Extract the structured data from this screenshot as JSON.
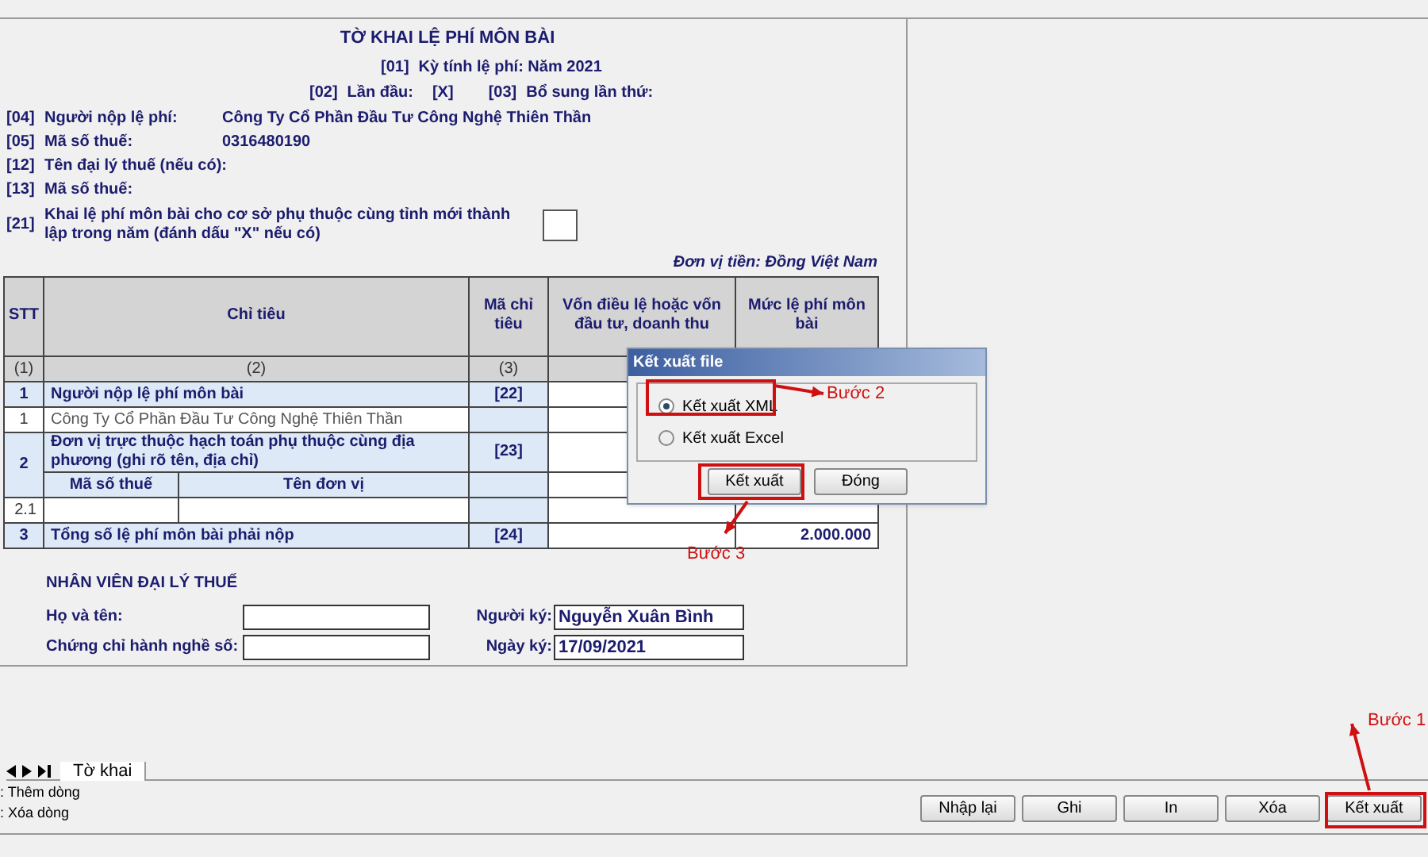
{
  "form": {
    "title": "TỜ KHAI LỆ PHÍ MÔN BÀI",
    "period": {
      "code": "[01]",
      "label": "Kỳ tính lệ phí: Năm 2021"
    },
    "first_time": {
      "code": "[02]",
      "label": "Lần đầu:",
      "value": "[X]"
    },
    "supplement": {
      "code": "[03]",
      "label": "Bổ sung lần thứ:"
    },
    "fields": [
      {
        "code": "[04]",
        "label": "Người nộp lệ phí:",
        "value": "Công Ty Cổ Phần Đầu Tư Công Nghệ Thiên Thần"
      },
      {
        "code": "[05]",
        "label": "Mã số thuế:",
        "value": "0316480190"
      },
      {
        "code": "[12]",
        "label": "Tên đại lý thuế (nếu có):"
      },
      {
        "code": "[13]",
        "label": "Mã số thuế:"
      }
    ],
    "dependent_checkbox": {
      "code": "[21]",
      "label": "Khai lệ phí môn bài cho cơ sở phụ thuộc cùng tỉnh mới thành lập trong năm (đánh dấu \"X\" nếu có)",
      "checked": false
    },
    "currency": "Đơn vị tiền: Đồng Việt Nam",
    "table": {
      "columns": [
        "STT",
        "Chỉ tiêu",
        "Mã chỉ tiêu",
        "Vốn điều lệ hoặc vốn đầu tư, doanh thu",
        "Mức lệ phí môn bài"
      ],
      "index_row": [
        "(1)",
        "(2)",
        "(3)"
      ],
      "rows": [
        {
          "kind": "section",
          "stt": "1",
          "label": "Người nộp lệ phí môn bài",
          "code": "[22]"
        },
        {
          "kind": "item",
          "stt": "1",
          "label": "Công Ty Cổ Phần Đầu Tư Công Nghệ Thiên Thần"
        },
        {
          "kind": "group",
          "stt": "2",
          "label": "Đơn vị trực thuộc hạch toán phụ thuộc cùng địa phương (ghi rõ tên, địa chỉ)",
          "code": "[23]"
        },
        {
          "kind": "subheader",
          "cells": [
            "Mã số thuế",
            "Tên đơn vị"
          ]
        },
        {
          "kind": "subrow",
          "stt": "2.1"
        },
        {
          "kind": "total",
          "stt": "3",
          "label": "Tổng số lệ phí môn bài phải nộp",
          "code": "[24]",
          "amount": "2.000.000"
        }
      ]
    },
    "agent": {
      "title": "NHÂN VIÊN ĐẠI LÝ THUẾ",
      "left_fields": [
        {
          "label": "Họ và tên:"
        },
        {
          "label": "Chứng chỉ hành nghề số:"
        }
      ],
      "right_fields": [
        {
          "label": "Người ký:",
          "value": "Nguyễn Xuân Bình"
        },
        {
          "label": "Ngày ký:",
          "value": "17/09/2021"
        }
      ]
    }
  },
  "dialog": {
    "title": "Kết xuất file",
    "options": [
      {
        "label": "Kết xuất XML",
        "selected": true
      },
      {
        "label": "Kết xuất Excel",
        "selected": false
      }
    ],
    "buttons": [
      "Kết xuất",
      "Đóng"
    ]
  },
  "sheet_tabs": [
    {
      "label": "Tờ khai",
      "selected": true
    }
  ],
  "row_actions": [
    ": Thêm dòng",
    ": Xóa dòng"
  ],
  "buttons": [
    "Nhập lại",
    "Ghi",
    "In",
    "Xóa",
    "Kết xuất"
  ],
  "annotations": [
    "Bước 2",
    "Bước 3",
    "Bước 1"
  ]
}
